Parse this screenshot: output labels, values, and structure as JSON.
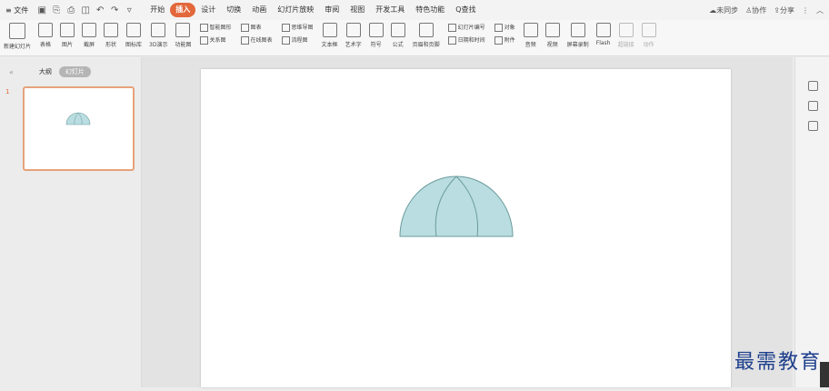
{
  "menu": {
    "file_label": "≡ 文件",
    "tabs": [
      "开始",
      "插入",
      "设计",
      "切换",
      "动画",
      "幻灯片放映",
      "审阅",
      "视图",
      "开发工具",
      "特色功能"
    ],
    "active_tab": "插入",
    "search_label": "Q查找"
  },
  "right_tools": {
    "sync": "未同步",
    "collab": "协作",
    "share": "分享"
  },
  "ribbon": {
    "new_slide": "新建幻灯片",
    "table": "表格",
    "picture": "图片",
    "screenshot": "截屏",
    "shape": "形状",
    "icon_lib": "图标库",
    "demo3d": "3D演示",
    "func_chart": "功能图",
    "smart_art": "智能图形",
    "chart": "图表",
    "relation": "关系图",
    "online_chart": "在线图表",
    "mindmap": "思维导图",
    "flowchart": "流程图",
    "textbox": "文本框",
    "wordart": "艺术字",
    "symbol": "符号",
    "formula": "公式",
    "header_footer": "页眉和页脚",
    "slide_num": "幻灯片编号",
    "object": "对象",
    "date_time": "日期和时间",
    "attach": "附件",
    "audio": "音频",
    "video": "视频",
    "screen_rec": "屏幕录制",
    "flash": "Flash",
    "hyperlink": "超链接",
    "action": "动作"
  },
  "left_pane": {
    "outline_tab": "大纲",
    "slides_tab": "幻灯片",
    "slide_number": "1"
  },
  "watermark": "最需教育",
  "colors": {
    "accent": "#e2683c",
    "dome_fill": "#b9dde1",
    "dome_stroke": "#6b9b9b"
  }
}
